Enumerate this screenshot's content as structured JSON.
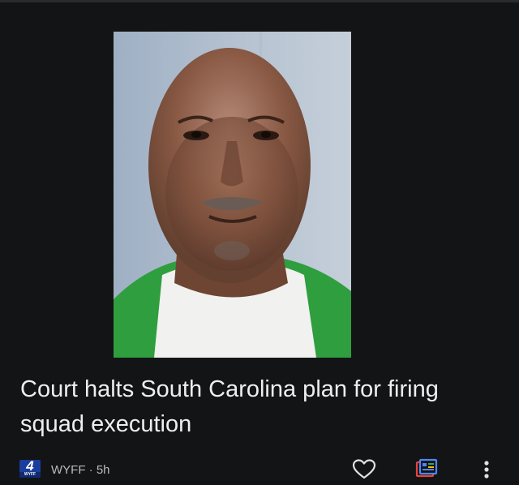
{
  "article": {
    "headline": "Court halts South Carolina plan for firing squad execution",
    "source": {
      "logo_number": "4",
      "logo_text": "WYFF",
      "byline": "WYFF · 5h"
    },
    "image": {
      "kind": "portrait photo"
    }
  },
  "actions": {
    "like_icon": "heart-outline-icon",
    "full_coverage_icon": "full-coverage-icon",
    "more_icon": "more-vert-icon"
  },
  "colors": {
    "background": "#131415",
    "headline": "#eceef0",
    "byline": "#b9bcc0",
    "logo_blue": "#1a3e9e",
    "full_coverage_blue": "#4f86f7",
    "full_coverage_red": "#ea4335",
    "full_coverage_yellow": "#fbbc04",
    "full_coverage_green": "#34a853"
  }
}
